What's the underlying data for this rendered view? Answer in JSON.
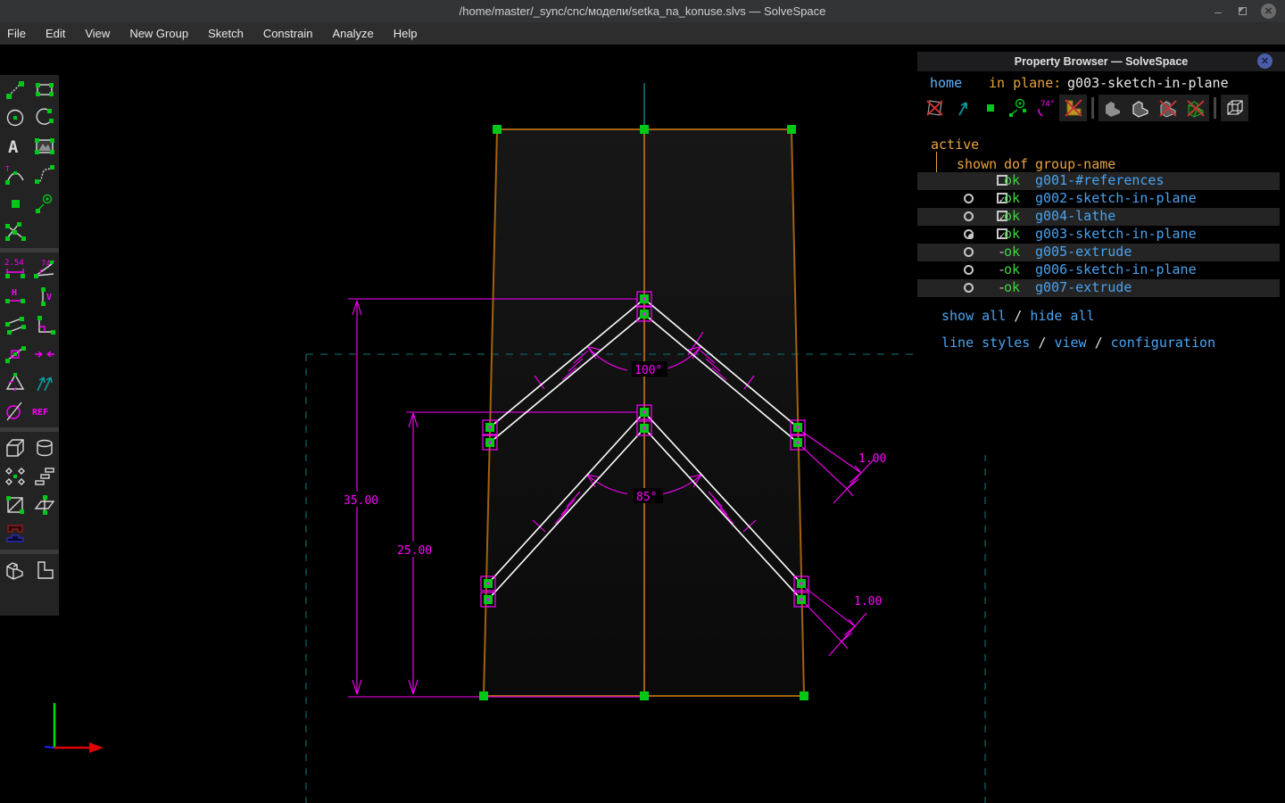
{
  "window": {
    "title": "/home/master/_sync/cnc/модели/setka_na_konuse.slvs — SolveSpace",
    "minimize_glyph": "–",
    "close_glyph": "✕"
  },
  "menu": {
    "items": [
      "File",
      "Edit",
      "View",
      "New Group",
      "Sketch",
      "Constrain",
      "Analyze",
      "Help"
    ]
  },
  "left_toolbar": {
    "sketch_tools": [
      "line-tool",
      "rectangle-tool",
      "circle-tool",
      "arc-tool",
      "text-tool",
      "image-tool",
      "tangent-arc-tool",
      "bezier-tool",
      "point-tool",
      "construction-tool",
      "split-curves-tool"
    ],
    "constraint_tools": [
      "distance-tool",
      "angle-tool",
      "horizontal-tool",
      "vertical-tool",
      "parallel-tool",
      "perpendicular-tool",
      "point-on-element-tool",
      "symmetric-tool",
      "equal-tool",
      "oriented-same-tool",
      "supplementary-angle-tool",
      "reference-dim-tool"
    ],
    "group_tools": [
      "extrude-tool",
      "lathe-tool",
      "rotate-copy-tool",
      "translate-copy-tool",
      "link-tool",
      "workplane-tool",
      "assemble-tool"
    ],
    "view_tools": [
      "iso-view-tool",
      "ortho-view-tool"
    ],
    "labels": {
      "tangent_t": "T",
      "distance": "2.54",
      "angle": "74°",
      "horizontal": "H",
      "vertical": "V",
      "ref": "REF"
    }
  },
  "property_browser": {
    "title": "Property Browser — SolveSpace",
    "nav": {
      "home": "home",
      "in_plane_label": "in plane:",
      "in_plane_value": "g003-sketch-in-plane"
    },
    "toolbar_icons": [
      "workplanes-toggle",
      "normals-toggle",
      "points-toggle",
      "construction-toggle",
      "constraints-toggle",
      "faces-toggle",
      "shaded-toggle",
      "edges-toggle",
      "outlines-toggle",
      "mesh-toggle",
      "occluded-lines-toggle"
    ],
    "toolbar_angle_label": "74°",
    "table": {
      "active_label": "active",
      "columns": [
        "shown",
        "dof",
        "group-name"
      ],
      "rows": [
        {
          "active": "none",
          "shown": "unchecked",
          "dof": "ok",
          "name": "g001-#references"
        },
        {
          "active": "off",
          "shown": "checked",
          "dof": "ok",
          "name": "g002-sketch-in-plane"
        },
        {
          "active": "off",
          "shown": "checked",
          "dof": "ok",
          "name": "g004-lathe"
        },
        {
          "active": "on",
          "shown": "checked",
          "dof": "ok",
          "name": "g003-sketch-in-plane"
        },
        {
          "active": "off",
          "shown": "dash",
          "dof": "ok",
          "name": "g005-extrude"
        },
        {
          "active": "off",
          "shown": "dash",
          "dof": "ok",
          "name": "g006-sketch-in-plane"
        },
        {
          "active": "off",
          "shown": "dash",
          "dof": "ok",
          "name": "g007-extrude"
        }
      ]
    },
    "links": {
      "show_all": "show all",
      "hide_all": "hide all",
      "line_styles": "line styles",
      "view": "view",
      "configuration": "configuration"
    }
  },
  "canvas": {
    "labels": {
      "d35": "35.00",
      "d25": "25.00",
      "a100": "100°",
      "a85": "85°",
      "gap1": "1.00",
      "gap2": "1.00"
    }
  },
  "glyphs": {
    "check": "✓",
    "dash": "-",
    "slash": "/"
  },
  "colors": {
    "dimension_magenta": "#ff00ff",
    "outline_orange": "#a2620f",
    "point_green": "#00c818",
    "ref_teal": "#0d8888",
    "dashed_teal": "#0a6060",
    "link_blue": "#4aa3f0",
    "header_orange": "#e8a33d",
    "ok_green": "#3ed63e",
    "axis_red": "#e00000",
    "axis_green": "#00dd00",
    "axis_blue": "#2020ff"
  }
}
